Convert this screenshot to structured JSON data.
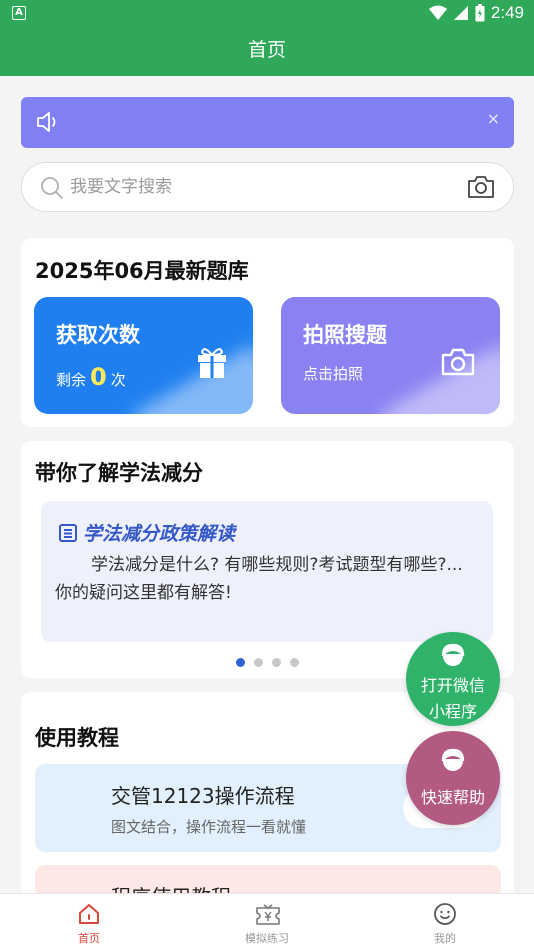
{
  "status_bar": {
    "time": "2:49",
    "app_badge": "A"
  },
  "header": {
    "title": "首页"
  },
  "notice": {
    "close_symbol": "×"
  },
  "search": {
    "placeholder": "我要文字搜索"
  },
  "question_bank": {
    "title": "2025年06月最新题库",
    "fetch_tile": {
      "title": "获取次数",
      "remaining_prefix": "剩余",
      "remaining_count": "0",
      "remaining_unit": "次"
    },
    "photo_tile": {
      "title": "拍照搜题",
      "subtitle": "点击拍照"
    }
  },
  "learn_section": {
    "title": "带你了解学法减分",
    "policy_card": {
      "title": "学法减分政策解读",
      "body": "学法减分是什么? 有哪些规则?考试题型有哪些?...你的疑问这里都有解答!"
    },
    "carousel_page": 1,
    "carousel_pages": 4
  },
  "tutorial_section": {
    "title": "使用教程",
    "items": [
      {
        "title": "交管12123操作流程",
        "subtitle": "图文结合，操作流程一看就懂"
      },
      {
        "title": "程序使用教程"
      }
    ]
  },
  "floating": {
    "wechat_label_1": "打开微信",
    "wechat_label_2": "小程序",
    "help_label": "快速帮助"
  },
  "tabbar": {
    "items": [
      {
        "label": "首页",
        "icon": "home-icon",
        "active": true
      },
      {
        "label": "模拟练习",
        "icon": "practice-icon",
        "active": false
      },
      {
        "label": "我的",
        "icon": "profile-icon",
        "active": false
      }
    ]
  },
  "colors": {
    "header_green": "#2fa85a",
    "notice_purple": "#8080f4",
    "fetch_tile_blue": "#1f7ff0",
    "photo_tile_purple": "#8a82f2",
    "wechat_fab_green": "#2fb36a",
    "help_fab_pink": "#b25a82",
    "active_tab_red": "#d9463a"
  }
}
